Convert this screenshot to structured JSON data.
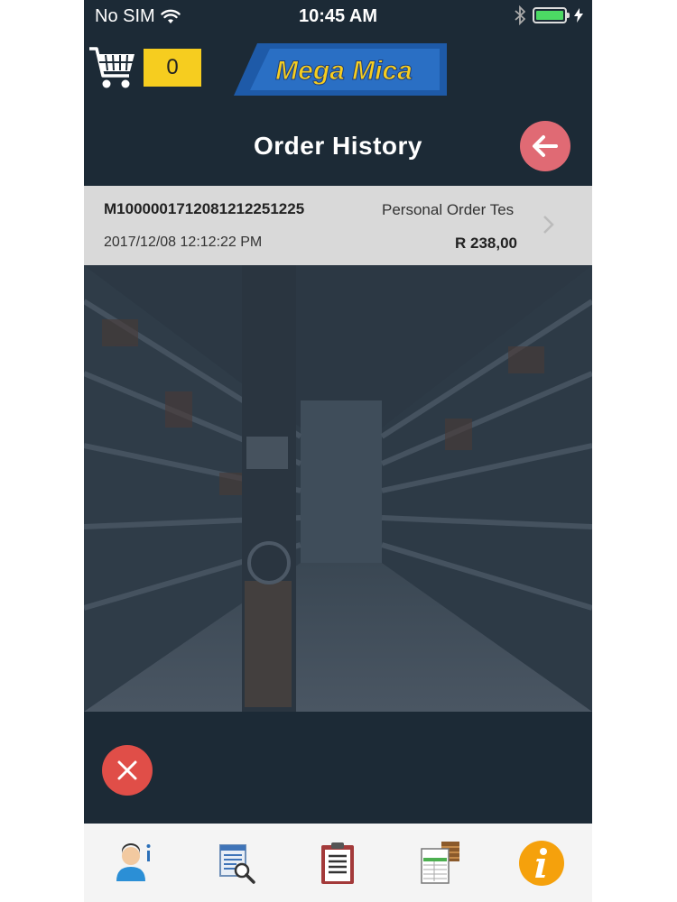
{
  "status_bar": {
    "carrier": "No SIM",
    "time": "10:45 AM",
    "battery_level": 1.0,
    "icons": [
      "wifi-icon",
      "bluetooth-icon",
      "battery-icon",
      "charging-bolt-icon"
    ]
  },
  "header": {
    "cart_count": "0",
    "logo_text": "Mega Mica",
    "page_title": "Order History",
    "back_icon": "arrow-left-icon"
  },
  "orders": [
    {
      "order_id": "M100000171208121225122​5",
      "name": "Personal Order Tes",
      "date": "2017/12/08 12:12:22 PM",
      "total": "R 238,00"
    }
  ],
  "actions": {
    "close_icon": "close-icon"
  },
  "tab_bar": {
    "tabs": [
      {
        "icon": "user-info-icon"
      },
      {
        "icon": "catalog-search-icon"
      },
      {
        "icon": "clipboard-list-icon"
      },
      {
        "icon": "orders-icon"
      },
      {
        "icon": "info-icon"
      }
    ]
  },
  "colors": {
    "background": "#1c2a36",
    "accent_yellow": "#f6cd1f",
    "back_button": "#e06a74",
    "close_button": "#e04e48",
    "row_background": "#d9d9d9"
  }
}
